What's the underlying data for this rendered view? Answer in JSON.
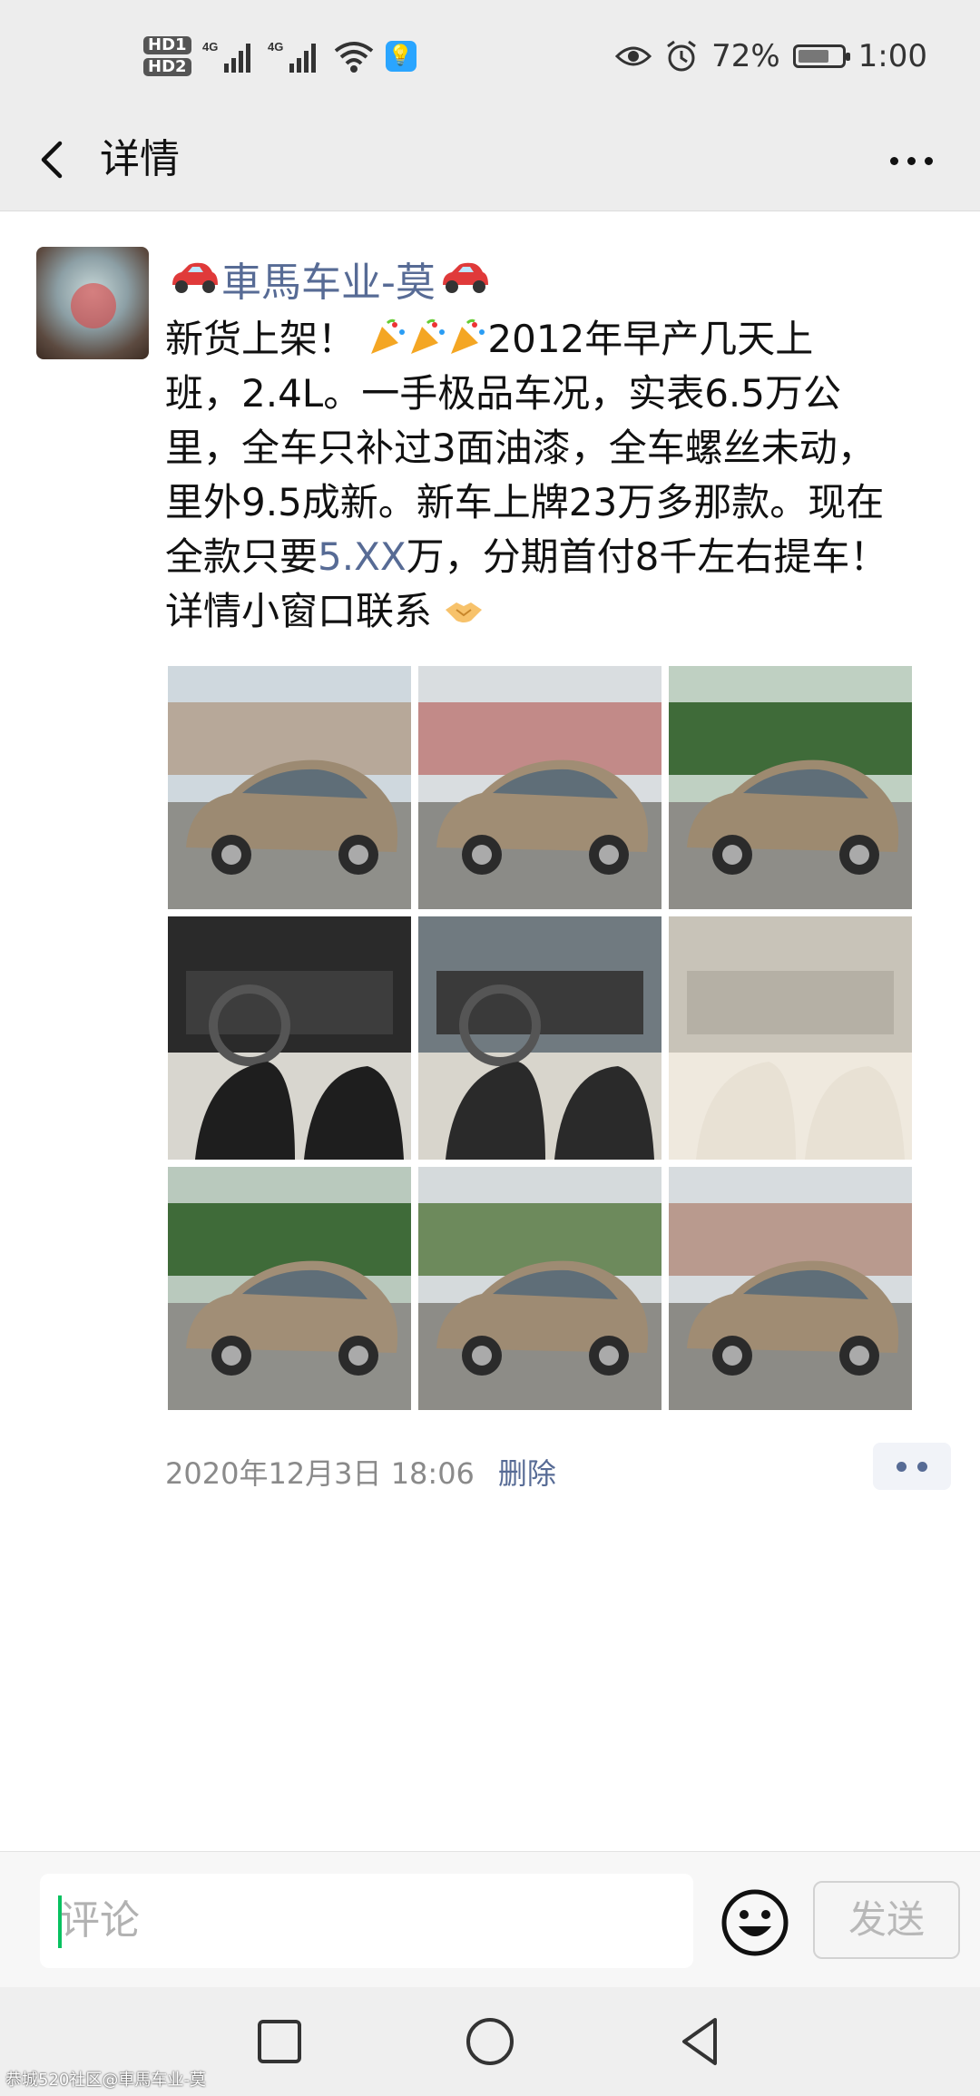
{
  "status_bar": {
    "hd1": "HD1",
    "hd2": "HD2",
    "sim1": "4G",
    "sim2": "4G",
    "battery_percent": "72%",
    "battery_level": 0.72,
    "time": "1:00",
    "icons": [
      "eye-icon",
      "alarm-icon",
      "battery-icon",
      "wifi-icon",
      "signal-icon",
      "bulb-icon"
    ]
  },
  "nav": {
    "title": "详情",
    "back_icon": "chevron-left-icon",
    "more_icon": "more-dots-icon"
  },
  "post": {
    "author": "車馬车业-莫",
    "text_line1_prefix": "新货上架！",
    "text_line1_suffix": "2012年早产几天上",
    "text_line2": "班，2.4L。一手极品车况，实表6.5万公",
    "text_line3": "里，全车只补过3面油漆，全车螺丝未动，",
    "text_line4": "里外9.5成新。新车上牌23万多那款。现在",
    "text_line5_prefix": "全款只要",
    "text_line5_link": "5.XX",
    "text_line5_suffix": "万，分期首付8千左右提车！",
    "text_line6": "详情小窗口联系",
    "images": [
      {
        "name": "car-front-left-photo"
      },
      {
        "name": "car-front-photo"
      },
      {
        "name": "car-front-right-photo"
      },
      {
        "name": "car-dashboard-photo"
      },
      {
        "name": "car-interior-photo"
      },
      {
        "name": "car-rear-seat-photo"
      },
      {
        "name": "car-rear-left-photo"
      },
      {
        "name": "car-rear-photo"
      },
      {
        "name": "car-rear-right-photo"
      }
    ],
    "timestamp": "2020年12月3日 18:06",
    "delete_label": "删除"
  },
  "comment": {
    "placeholder": "评论",
    "send_label": "发送"
  },
  "watermark": "恭城520社区@車馬车业-莫",
  "colors": {
    "link": "#576b95",
    "accent": "#07c160",
    "bar_bg": "#ededed"
  }
}
